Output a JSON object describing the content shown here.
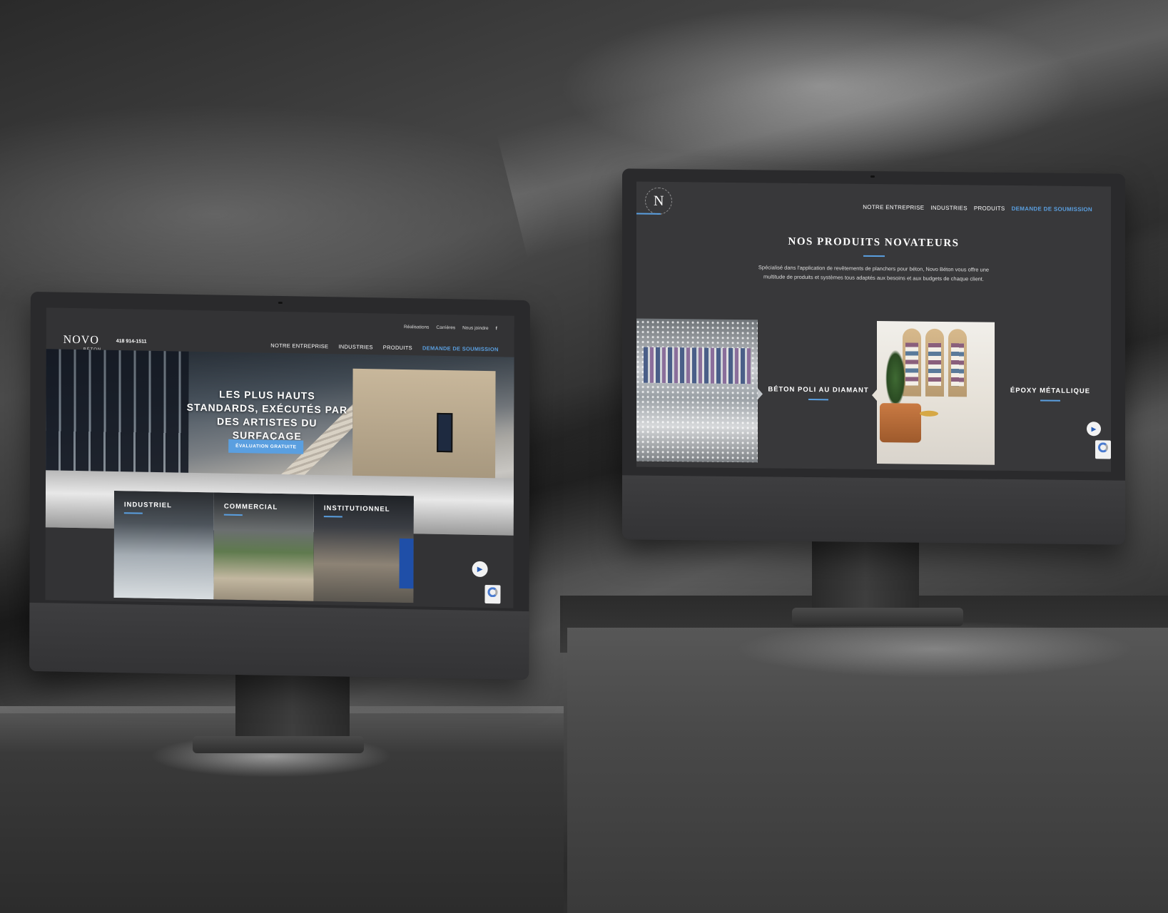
{
  "left_screen": {
    "utility_links": [
      "Réalisations",
      "Carrières",
      "Nous joindre"
    ],
    "facebook_icon": "facebook-icon",
    "logo": {
      "name": "NOVO",
      "sub": "BÉTON"
    },
    "phone": "418 914-1511",
    "nav": {
      "items": [
        "NOTRE ENTREPRISE",
        "INDUSTRIES",
        "PRODUITS"
      ],
      "cta": "DEMANDE DE SOUMISSION"
    },
    "hero": {
      "headline": "LES PLUS HAUTS STANDARDS, EXÉCUTÉS PAR DES ARTISTES DU SURFAÇAGE",
      "cta": "ÉVALUATION GRATUITE"
    },
    "tiles": [
      "INDUSTRIEL",
      "COMMERCIAL",
      "INSTITUTIONNEL"
    ]
  },
  "right_screen": {
    "logo": {
      "letter": "N",
      "ring_text": "NOVO BÉTON"
    },
    "nav": {
      "items": [
        "NOTRE ENTREPRISE",
        "INDUSTRIES",
        "PRODUITS"
      ],
      "cta": "DEMANDE DE SOUMISSION"
    },
    "section_title": "NOS PRODUITS NOVATEURS",
    "description": "Spécialisé dans l'application de revêtements de planchers pour béton, Novo Béton vous offre une multitude de produits et systèmes tous adaptés aux besoins et aux budgets de chaque client.",
    "products": [
      "BÉTON POLI AU DIAMANT",
      "ÉPOXY MÉTALLIQUE"
    ]
  },
  "colors": {
    "accent": "#5a9fe0",
    "screen_bg": "#38383a"
  },
  "icons": {
    "play": "play-icon",
    "recaptcha": "recaptcha-icon"
  }
}
